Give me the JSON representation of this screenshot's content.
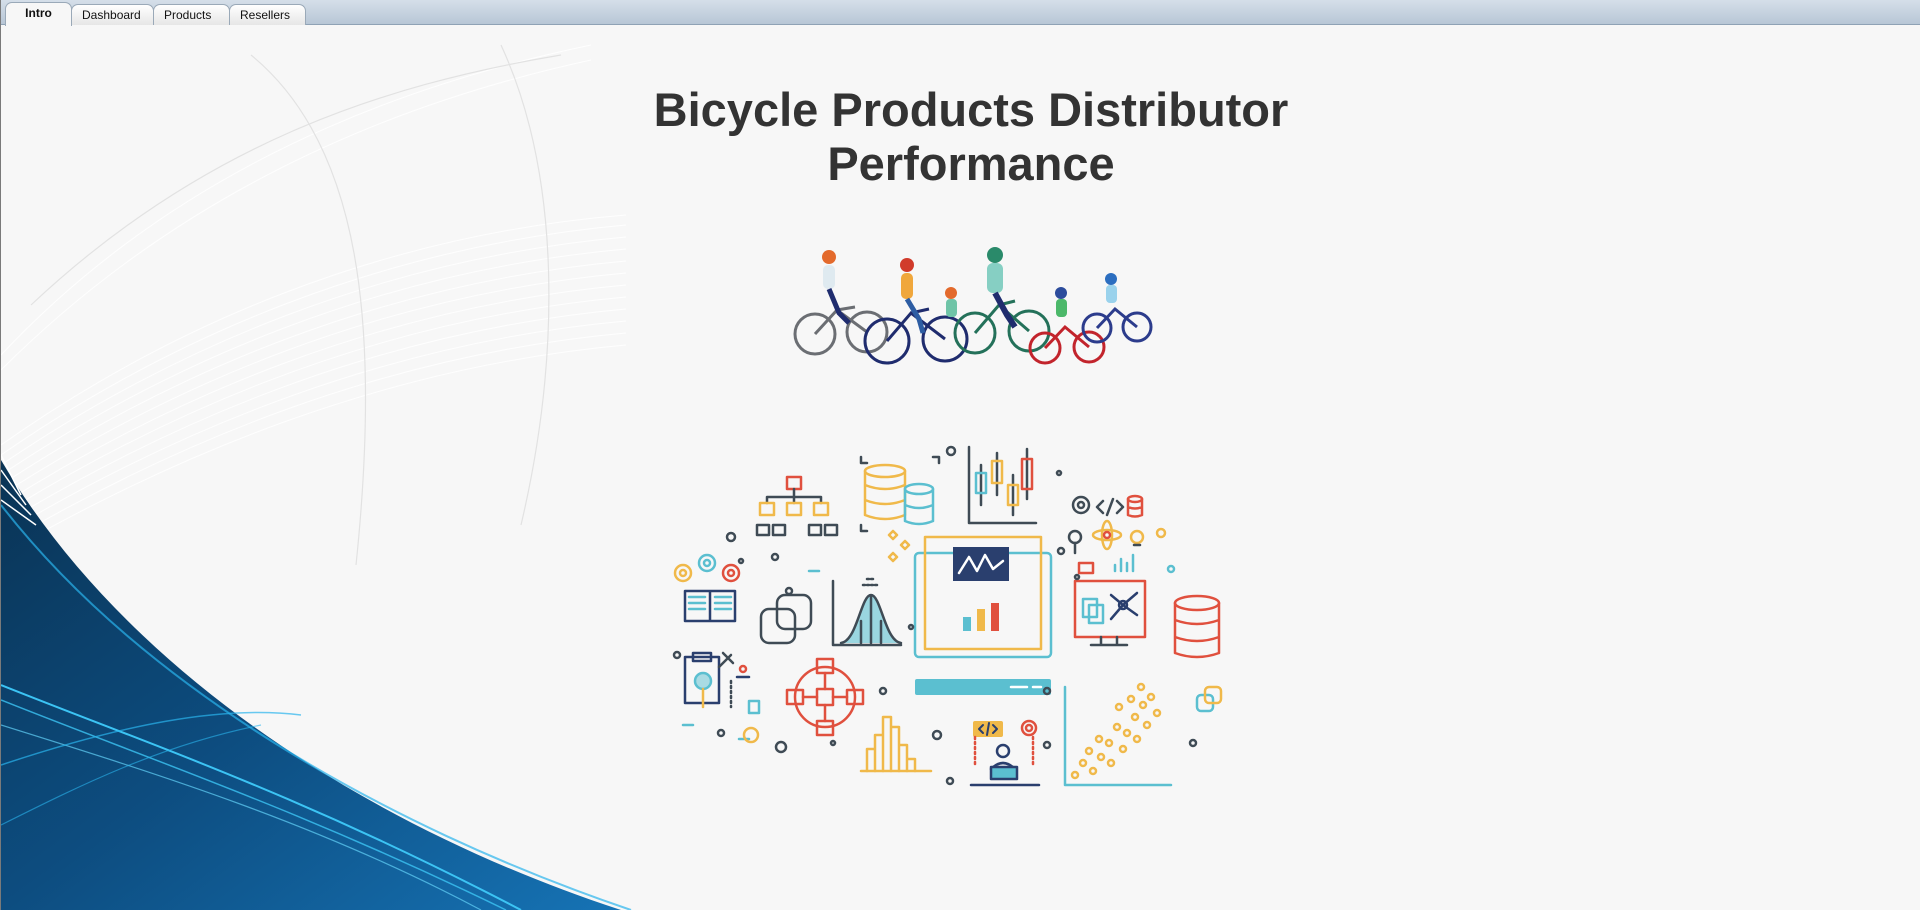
{
  "tabs": [
    {
      "label": "Intro",
      "active": true
    },
    {
      "label": "Dashboard",
      "active": false
    },
    {
      "label": "Products",
      "active": false
    },
    {
      "label": "Resellers",
      "active": false
    }
  ],
  "page": {
    "title_line1": "Bicycle Products Distributor",
    "title_line2": "Performance"
  },
  "colors": {
    "title": "#333333",
    "background": "#f7f7f7",
    "wave_dark": "#0b3f66",
    "wave_mid": "#135f98",
    "wave_light": "#2ab4ec",
    "icon_teal": "#5bbfd0",
    "icon_orange": "#f0b94a",
    "icon_red": "#e0503e",
    "icon_navy": "#2a3f6e",
    "icon_gray": "#3f4b55"
  },
  "images": {
    "bikes": "family-cycling-illustration",
    "analytics": "data-analytics-icon-collage"
  }
}
